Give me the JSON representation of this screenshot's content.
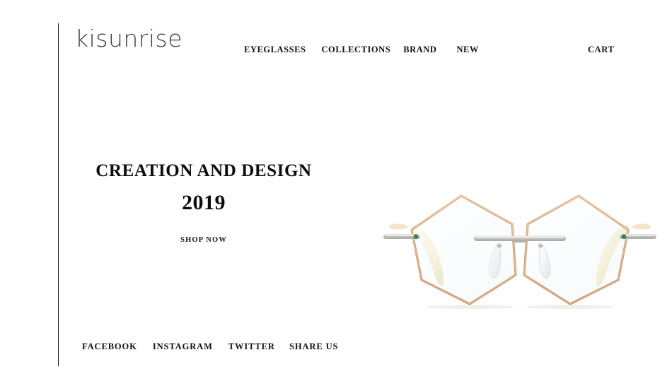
{
  "site": {
    "brand": "kisunrise",
    "background_color": "#ffffff",
    "text_color": "#111111"
  },
  "header": {
    "logo": "kisunrise",
    "nav": [
      {
        "label": "EYEGLASSES"
      },
      {
        "label": "COLLECTIONS"
      },
      {
        "label": "BRAND"
      },
      {
        "label": "NEW"
      }
    ],
    "cart_label": "CART"
  },
  "hero": {
    "title": "CREATION AND DESIGN",
    "year": "2019",
    "cta_label": "SHOP NOW",
    "product": {
      "name": "rimless-hexagonal-eyeglasses",
      "frame_color": "#d6a87f",
      "temple_color": "#f0e4b8",
      "bridge_color": "#b9b9b3",
      "lens_color": "#fbfcfd",
      "accent_color": "#2f6b3a"
    }
  },
  "footer": {
    "social": [
      {
        "label": "FACEBOOK"
      },
      {
        "label": "INSTAGRAM"
      },
      {
        "label": "TWITTER"
      }
    ],
    "share_label": "SHARE US"
  }
}
